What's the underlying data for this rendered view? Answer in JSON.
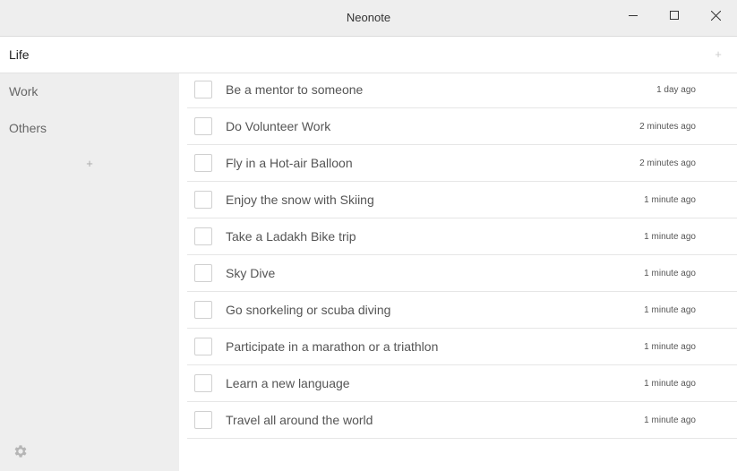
{
  "window": {
    "title": "Neonote",
    "controls": [
      "minimize-icon",
      "maximize-icon",
      "close-icon"
    ]
  },
  "sidebar": {
    "items": [
      {
        "label": "Life",
        "active": true
      },
      {
        "label": "Work",
        "active": false
      },
      {
        "label": "Others",
        "active": false
      }
    ],
    "add_label": "+",
    "settings_icon": "gear-icon"
  },
  "list": {
    "add_label": "+",
    "tasks": [
      {
        "text": "Be a mentor to someone",
        "time": "1 day ago",
        "checked": false
      },
      {
        "text": "Do Volunteer Work",
        "time": "2 minutes ago",
        "checked": false
      },
      {
        "text": "Fly in a Hot-air Balloon",
        "time": "2 minutes ago",
        "checked": false
      },
      {
        "text": "Enjoy the snow with Skiing",
        "time": "1 minute ago",
        "checked": false
      },
      {
        "text": "Take a Ladakh Bike trip",
        "time": "1 minute ago",
        "checked": false
      },
      {
        "text": "Sky Dive",
        "time": "1 minute ago",
        "checked": false
      },
      {
        "text": "Go snorkeling or scuba diving",
        "time": "1 minute ago",
        "checked": false
      },
      {
        "text": "Participate in a marathon or a triathlon",
        "time": "1 minute ago",
        "checked": false
      },
      {
        "text": "Learn a new language",
        "time": "1 minute ago",
        "checked": false
      },
      {
        "text": "Travel all around the world",
        "time": "1 minute ago",
        "checked": false
      }
    ]
  },
  "colors": {
    "chrome": "#eeeeee",
    "active_bg": "#ffffff",
    "text": "#555555",
    "divider": "#e6e6e6"
  }
}
